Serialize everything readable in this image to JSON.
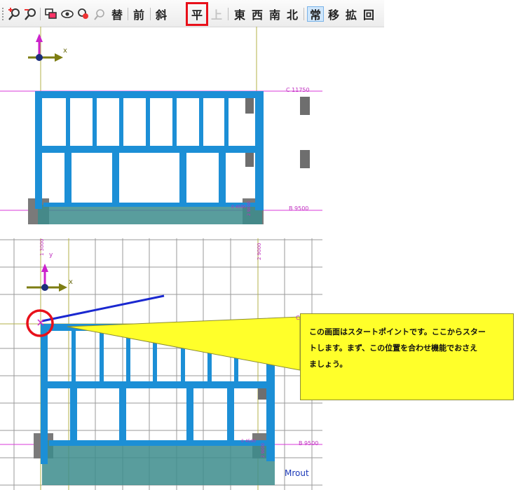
{
  "toolbar": {
    "buttons": [
      {
        "id": "zoom-in",
        "label": "",
        "icon": "zoom-in-icon"
      },
      {
        "id": "zoom-out",
        "label": "",
        "icon": "zoom-out-icon"
      },
      {
        "id": "view-tool-1",
        "label": "",
        "icon": "display-icon"
      },
      {
        "id": "eye",
        "label": "",
        "icon": "eye-icon"
      },
      {
        "id": "pick",
        "label": "",
        "icon": "pick-icon"
      },
      {
        "id": "rotate",
        "label": "",
        "icon": "rotate-view-icon"
      },
      {
        "id": "kae",
        "label": "替"
      },
      {
        "id": "mae",
        "label": "前"
      },
      {
        "id": "naname",
        "label": "斜"
      },
      {
        "id": "hira",
        "label": "平"
      },
      {
        "id": "ue",
        "label": "上"
      },
      {
        "id": "higashi",
        "label": "東"
      },
      {
        "id": "nishi",
        "label": "西"
      },
      {
        "id": "minami",
        "label": "南"
      },
      {
        "id": "kita",
        "label": "北"
      },
      {
        "id": "tsune",
        "label": "常"
      },
      {
        "id": "utsuri",
        "label": "移"
      },
      {
        "id": "kaku",
        "label": "拡"
      },
      {
        "id": "kai",
        "label": "回"
      }
    ]
  },
  "top_view": {
    "axis_x_label": "x",
    "grid_c_label": "C 11750",
    "grid_b_label": "B 9500",
    "small_label": "0 4500",
    "small_label_2": "2 9000"
  },
  "bottom_view": {
    "axis_x_label": "x",
    "axis_y_label": "y",
    "grid_label_top_left": "1 3000",
    "grid_label_top_right": "2 9000",
    "grid_b_label": "B 9500",
    "small_label": "0 4500",
    "small_label_2": "2 9000",
    "grid_c_label": "C"
  },
  "callout": {
    "text": "この画面はスタートポイントです。ここからスター\nトします。まず、この位置を合わせ機能でおさえ\nましょう。"
  },
  "status": {
    "mode_label": "Mrout"
  },
  "colors": {
    "frame_blue": "#1c8fd6",
    "grid_line": "#8a8a8a",
    "highlight_red": "#e8101a",
    "callout_yellow": "#ffff2a",
    "axis_magenta": "#cc22cc",
    "axis_olive": "#7d7d12"
  }
}
